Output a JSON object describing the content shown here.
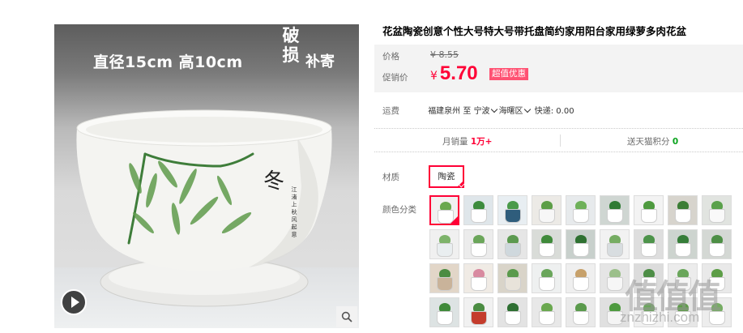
{
  "photo": {
    "banner_text": "直径15cm  高10cm",
    "tag_break": "破损",
    "tag_free": "补寄",
    "pot_character": "冬",
    "pot_verse": "江 渚 上 秋 风 起 意",
    "play_icon": "play-icon",
    "zoom_icon": "magnifier-icon"
  },
  "product": {
    "title": "花盆陶瓷创意个性大号特大号带托盘简约家用阳台家用绿萝多肉花盆"
  },
  "price": {
    "original_label": "价格",
    "original_value": "¥ 8.55",
    "sale_label": "促销价",
    "currency": "¥",
    "sale_value": "5.70",
    "promo_badge": "超值优惠"
  },
  "shipping": {
    "label": "运费",
    "from": "福建泉州",
    "to_word": "至",
    "dest_city": "宁波",
    "dest_district": "海曙区",
    "express": "快递: 0.00"
  },
  "stats": {
    "monthly_sales_label": "月销量",
    "monthly_sales_value": "1万+",
    "points_label": "送天猫积分",
    "points_value": "0"
  },
  "options": {
    "material_label": "材质",
    "material_value": "陶瓷",
    "color_label": "颜色分类"
  },
  "colors": {
    "accent": "#ff0036",
    "promo_bg": "#ff5172",
    "points_green": "#0aa31e",
    "price_box_bg": "#f3f3f3"
  },
  "watermark": {
    "logo": "值值值",
    "url": "znzhizhi.com"
  }
}
